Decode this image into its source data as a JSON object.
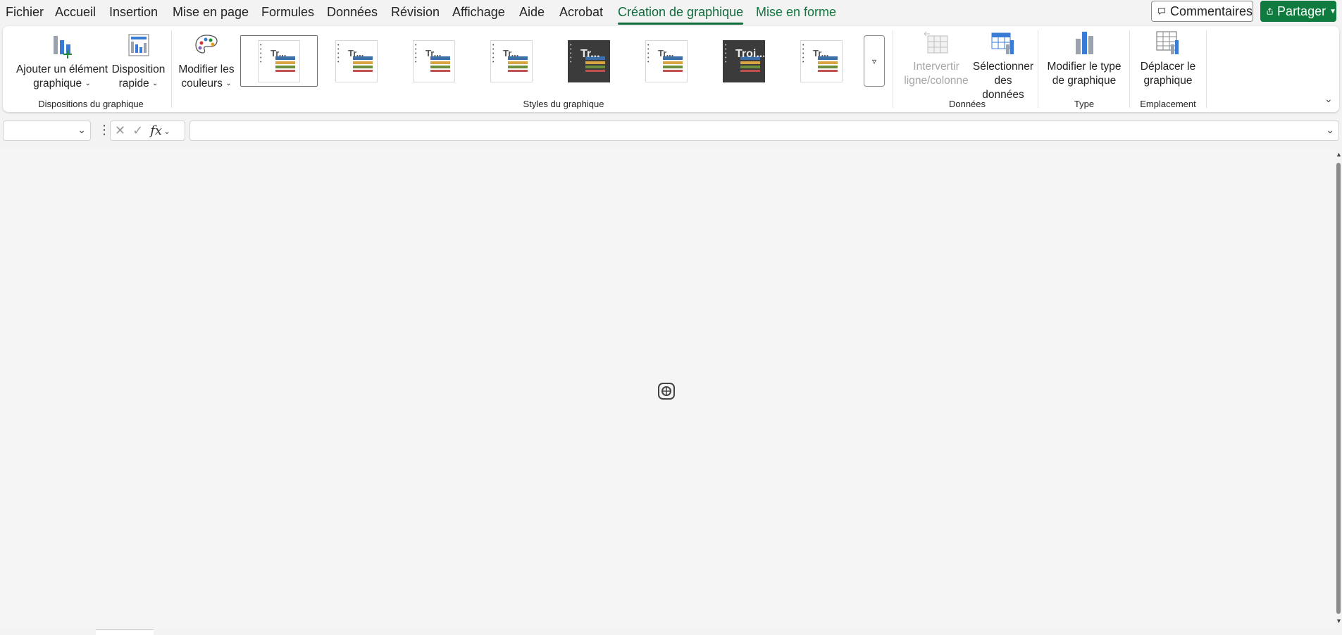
{
  "menu": {
    "items": [
      {
        "label": "Fichier"
      },
      {
        "label": "Accueil"
      },
      {
        "label": "Insertion"
      },
      {
        "label": "Mise en page"
      },
      {
        "label": "Formules"
      },
      {
        "label": "Données"
      },
      {
        "label": "Révision"
      },
      {
        "label": "Affichage"
      },
      {
        "label": "Aide"
      },
      {
        "label": "Acrobat"
      },
      {
        "label": "Création de graphique"
      },
      {
        "label": "Mise en forme"
      }
    ],
    "active_tab": "Création de graphique",
    "comments_label": "Commentaires",
    "share_label": "Partager"
  },
  "ribbon": {
    "layouts": {
      "add_element_line1": "Ajouter un élément",
      "add_element_line2": "graphique",
      "quick_layout_line1": "Disposition",
      "quick_layout_line2": "rapide",
      "group_label": "Dispositions du graphique"
    },
    "styles": {
      "change_colors_line1": "Modifier les",
      "change_colors_line2": "couleurs",
      "group_label": "Styles du graphique",
      "thumbnails": [
        {
          "title": "Tr...",
          "dark": false,
          "selected": true
        },
        {
          "title": "Tr...",
          "dark": false,
          "selected": false
        },
        {
          "title": "Tr...",
          "dark": false,
          "selected": false
        },
        {
          "title": "Tr...",
          "dark": false,
          "selected": false
        },
        {
          "title": "Tr...",
          "dark": true,
          "selected": false
        },
        {
          "title": "Tr...",
          "dark": false,
          "selected": false
        },
        {
          "title": "Troi...",
          "dark": true,
          "selected": false
        },
        {
          "title": "Tr...",
          "dark": false,
          "selected": false
        }
      ]
    },
    "data": {
      "switch_line1": "Intervertir",
      "switch_line2": "ligne/colonne",
      "select_line1": "Sélectionner",
      "select_line2": "des données",
      "group_label": "Données"
    },
    "type": {
      "change_type_line1": "Modifier le type",
      "change_type_line2": "de graphique",
      "group_label": "Type"
    },
    "location": {
      "move_line1": "Déplacer le",
      "move_line2": "graphique",
      "group_label": "Emplacement"
    }
  },
  "formula_bar": {
    "name_box_value": "",
    "formula_value": "",
    "fx_label": "fx"
  },
  "colors": {
    "accent": "#0e6b3a",
    "share_bg": "#0f7b3f"
  }
}
